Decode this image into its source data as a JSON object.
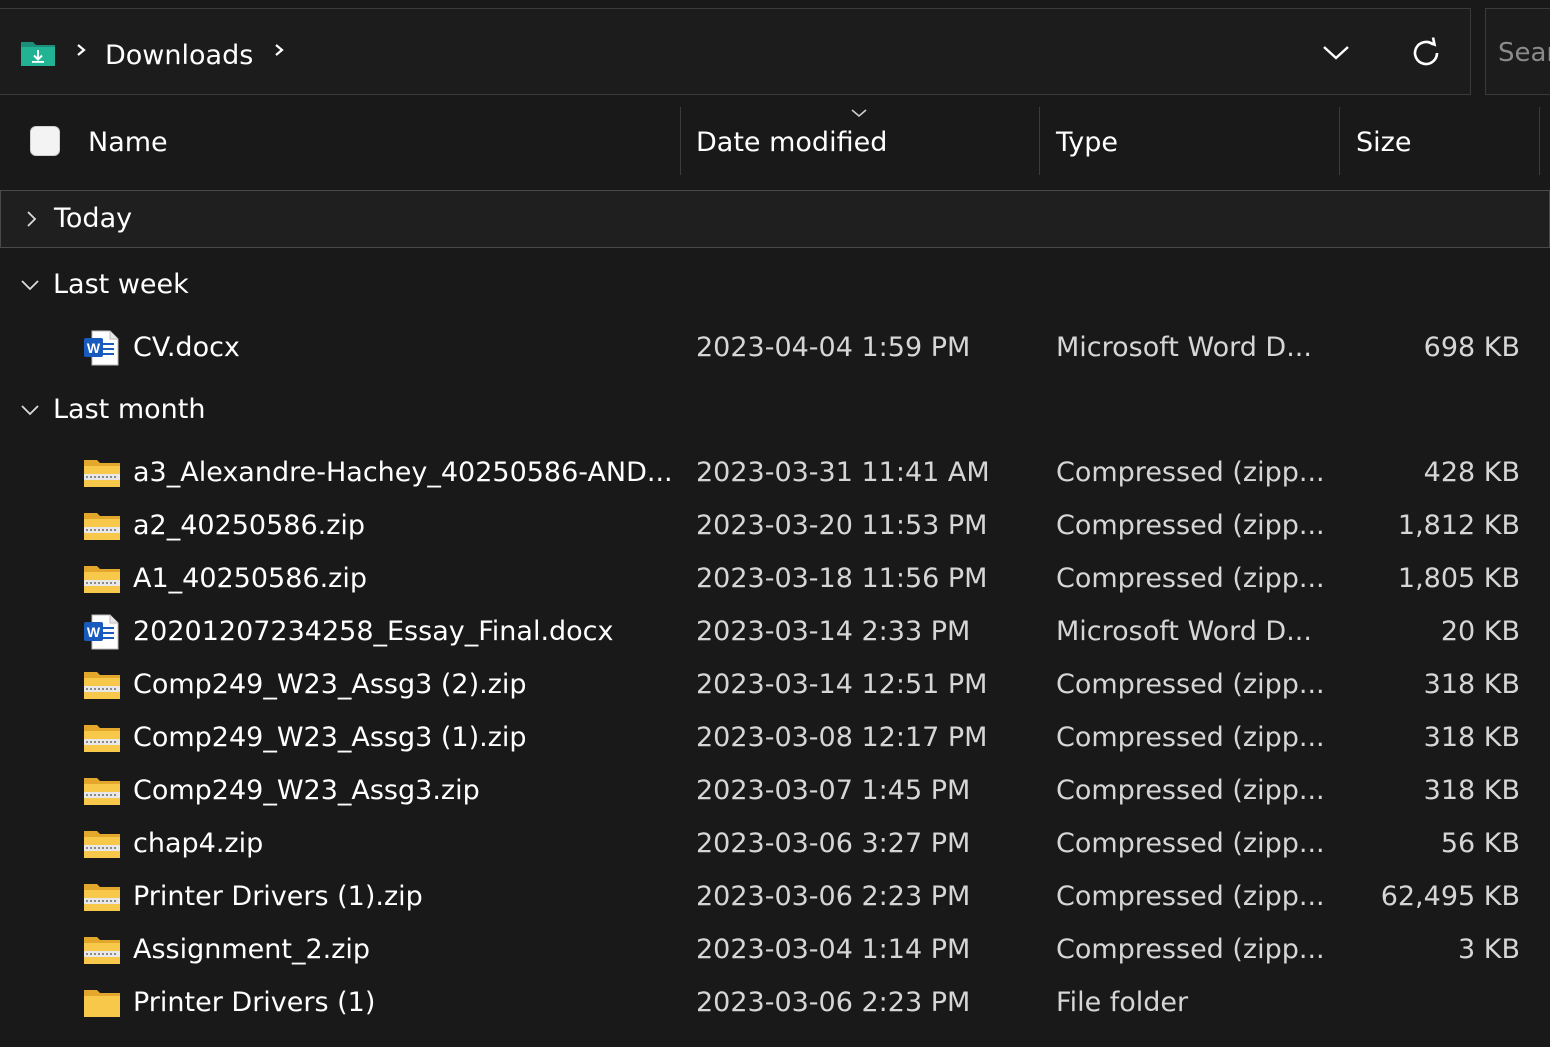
{
  "address_bar": {
    "current_folder": "Downloads"
  },
  "search": {
    "placeholder": "Search Downloads"
  },
  "columns": {
    "name": "Name",
    "date_modified": "Date modified",
    "type": "Type",
    "size": "Size"
  },
  "groups": {
    "today": {
      "label": "Today",
      "expanded": false
    },
    "last_week": {
      "label": "Last week",
      "expanded": true
    },
    "last_month": {
      "label": "Last month",
      "expanded": true
    }
  },
  "files": [
    {
      "name": "CV.docx",
      "date": "2023-04-04 1:59 PM",
      "type": "Microsoft Word D...",
      "size": "698 KB",
      "icon": "word-doc-icon"
    },
    {
      "name": "a3_Alexandre-Hachey_40250586-AND...",
      "date": "2023-03-31 11:41 AM",
      "type": "Compressed (zipp...",
      "size": "428 KB",
      "icon": "zip-folder-icon"
    },
    {
      "name": "a2_40250586.zip",
      "date": "2023-03-20 11:53 PM",
      "type": "Compressed (zipp...",
      "size": "1,812 KB",
      "icon": "zip-folder-icon"
    },
    {
      "name": "A1_40250586.zip",
      "date": "2023-03-18 11:56 PM",
      "type": "Compressed (zipp...",
      "size": "1,805 KB",
      "icon": "zip-folder-icon"
    },
    {
      "name": "20201207234258_Essay_Final.docx",
      "date": "2023-03-14 2:33 PM",
      "type": "Microsoft Word D...",
      "size": "20 KB",
      "icon": "word-doc-icon"
    },
    {
      "name": "Comp249_W23_Assg3 (2).zip",
      "date": "2023-03-14 12:51 PM",
      "type": "Compressed (zipp...",
      "size": "318 KB",
      "icon": "zip-folder-icon"
    },
    {
      "name": "Comp249_W23_Assg3 (1).zip",
      "date": "2023-03-08 12:17 PM",
      "type": "Compressed (zipp...",
      "size": "318 KB",
      "icon": "zip-folder-icon"
    },
    {
      "name": "Comp249_W23_Assg3.zip",
      "date": "2023-03-07 1:45 PM",
      "type": "Compressed (zipp...",
      "size": "318 KB",
      "icon": "zip-folder-icon"
    },
    {
      "name": "chap4.zip",
      "date": "2023-03-06 3:27 PM",
      "type": "Compressed (zipp...",
      "size": "56 KB",
      "icon": "zip-folder-icon"
    },
    {
      "name": "Printer Drivers (1).zip",
      "date": "2023-03-06 2:23 PM",
      "type": "Compressed (zipp...",
      "size": "62,495 KB",
      "icon": "zip-folder-icon"
    },
    {
      "name": "Assignment_2.zip",
      "date": "2023-03-04 1:14 PM",
      "type": "Compressed (zipp...",
      "size": "3 KB",
      "icon": "zip-folder-icon"
    },
    {
      "name": "Printer Drivers (1)",
      "date": "2023-03-06 2:23 PM",
      "type": "File folder",
      "size": "",
      "icon": "folder-icon"
    }
  ],
  "colors": {
    "background": "#191919",
    "folder_yellow": "#f8c84a",
    "word_blue": "#185abd",
    "downloads_teal": "#1fa88a"
  }
}
